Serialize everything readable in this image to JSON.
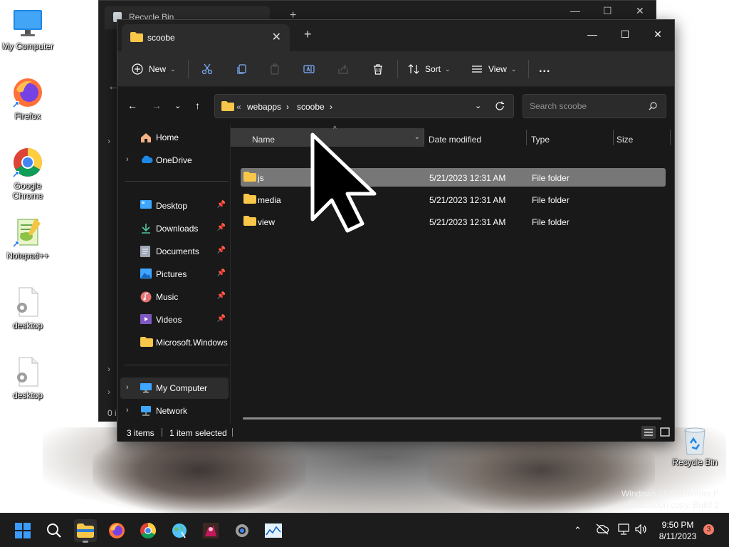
{
  "desktop": {
    "icons": [
      {
        "label": "My Computer",
        "icon": "monitor-icon"
      },
      {
        "label": "Firefox",
        "icon": "firefox-icon"
      },
      {
        "label": "Google Chrome",
        "icon": "chrome-icon"
      },
      {
        "label": "Notepad++",
        "icon": "notepadpp-icon"
      },
      {
        "label": "desktop",
        "icon": "settings-file-icon"
      },
      {
        "label": "desktop",
        "icon": "settings-file-icon"
      }
    ],
    "recycle_bin_label": "Recycle Bin",
    "watermark": {
      "line1": "Windows 11 Pro Insider P",
      "line2": "Evaluation copy. Build 2"
    }
  },
  "background_window": {
    "tab_title": "Recycle Bin",
    "status": "0 i"
  },
  "window": {
    "tab_title": "scoobe",
    "new_tab_label": "+",
    "controls": {
      "minimize": "—",
      "maximize": "☐",
      "close": "✕"
    },
    "toolbar": {
      "new_label": "New",
      "sort_label": "Sort",
      "view_label": "View",
      "more_label": "..."
    },
    "address": {
      "overflow": "«",
      "crumbs": [
        "webapps",
        "scoobe"
      ]
    },
    "search": {
      "placeholder": "Search scoobe"
    },
    "nav": {
      "home": "Home",
      "onedrive": "OneDrive",
      "quick": [
        "Desktop",
        "Downloads",
        "Documents",
        "Pictures",
        "Music",
        "Videos",
        "Microsoft.Windows"
      ],
      "my_computer": "My Computer",
      "network": "Network"
    },
    "columns": {
      "name": "Name",
      "date": "Date modified",
      "type": "Type",
      "size": "Size"
    },
    "files": [
      {
        "name": "js",
        "date": "5/21/2023 12:31 AM",
        "type": "File folder",
        "selected": true
      },
      {
        "name": "media",
        "date": "5/21/2023 12:31 AM",
        "type": "File folder",
        "selected": false
      },
      {
        "name": "view",
        "date": "5/21/2023 12:31 AM",
        "type": "File folder",
        "selected": false
      }
    ],
    "status": {
      "count": "3 items",
      "selection": "1 item selected"
    }
  },
  "taskbar": {
    "apps": [
      "start-icon",
      "search-icon",
      "file-explorer-icon",
      "firefox-icon",
      "chrome-icon",
      "globe-icon",
      "image-app-icon",
      "settings-icon",
      "chart-app-icon"
    ],
    "clock": {
      "time": "9:50 PM",
      "date": "8/11/2023"
    },
    "notification_count": "3"
  },
  "colors": {
    "window_bg": "#191919",
    "toolbar_bg": "#2c2c2c",
    "selection": "#777777",
    "folder": "#f8c648",
    "taskbar": "#1c1c1c"
  }
}
